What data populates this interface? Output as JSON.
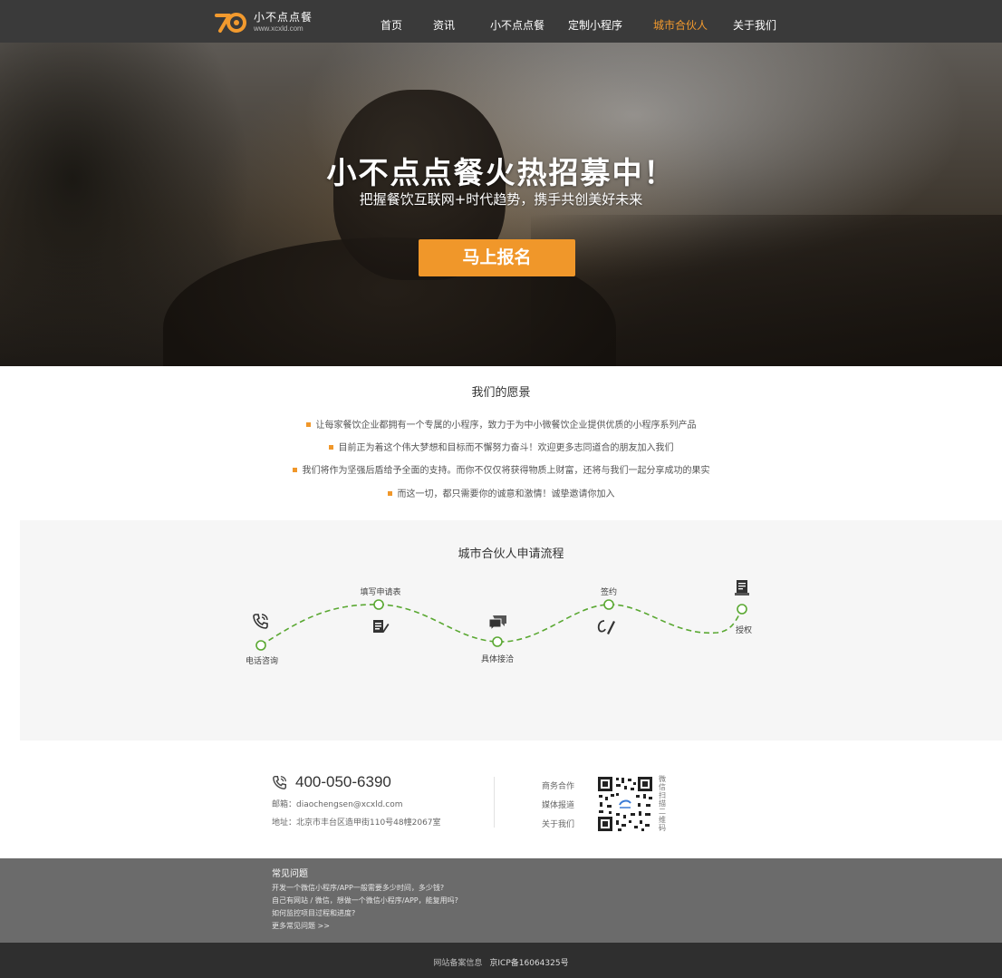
{
  "brand": {
    "name": "小不点点餐",
    "url": "www.xcxld.com",
    "accent": "#f29a2e"
  },
  "nav": {
    "items": [
      {
        "label": "首页"
      },
      {
        "label": "资讯"
      },
      {
        "label": "小不点点餐"
      },
      {
        "label": "定制小程序"
      },
      {
        "label": "城市合伙人"
      },
      {
        "label": "关于我们"
      }
    ],
    "active_label": "城市合伙人"
  },
  "hero": {
    "title": "小不点点餐火热招募中！",
    "subtitle": "把握餐饮互联网+时代趋势，携手共创美好未来",
    "cta_label": "马上报名",
    "cta_color": "#f0972a"
  },
  "vision": {
    "title": "我们的愿景",
    "items": [
      "让每家餐饮企业都拥有一个专属的小程序，致力于为中小微餐饮企业提供优质的小程序系列产品",
      "目前正为着这个伟大梦想和目标而不懈努力奋斗！欢迎更多志同道合的朋友加入我们",
      "我们将作为坚强后盾给予全面的支持。而你不仅仅将获得物质上财富，还将与我们一起分享成功的果实",
      "而这一切，都只需要你的诚意和激情！诚挚邀请你加入"
    ]
  },
  "process": {
    "title": "城市合伙人申请流程",
    "steps": [
      {
        "label": "电话咨询",
        "icon": "phone-icon"
      },
      {
        "label": "填写申请表",
        "icon": "form-edit-icon"
      },
      {
        "label": "具体接洽",
        "icon": "chat-icon"
      },
      {
        "label": "签约",
        "icon": "sign-pen-icon"
      },
      {
        "label": "授权",
        "icon": "certificate-icon"
      }
    ],
    "line_color": "#5aa832"
  },
  "contact": {
    "phone": "400-050-6390",
    "email": "邮箱：diaochengsen@xcxld.com",
    "address": "地址：北京市丰台区造甲街110号48幢2067室",
    "links": [
      "商务合作",
      "媒体报道",
      "关于我们"
    ],
    "qr_caption": "微信扫描二维码"
  },
  "faq": {
    "title": "常见问题",
    "items": [
      "开发一个微信小程序/APP一般需要多少时间，多少钱?",
      "自己有网站 / 微信，想做一个微信小程序/APP，能复用吗?",
      "如何监控项目过程和进度?",
      "更多常见问题  >>"
    ]
  },
  "footer": {
    "record_label": "网站备案信息",
    "icp": "京ICP备16064325号"
  }
}
